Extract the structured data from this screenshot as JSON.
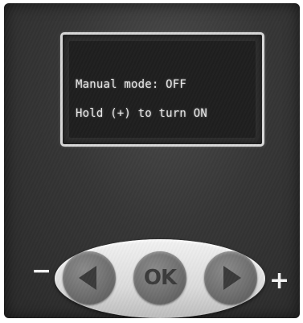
{
  "display": {
    "line1": "Manual mode: OFF",
    "line2": "Hold (+) to turn ON"
  },
  "keypad": {
    "ok_label": "OK",
    "minus_label": "−",
    "plus_label": "+",
    "left_icon": "left-triangle-icon",
    "right_icon": "right-triangle-icon"
  }
}
